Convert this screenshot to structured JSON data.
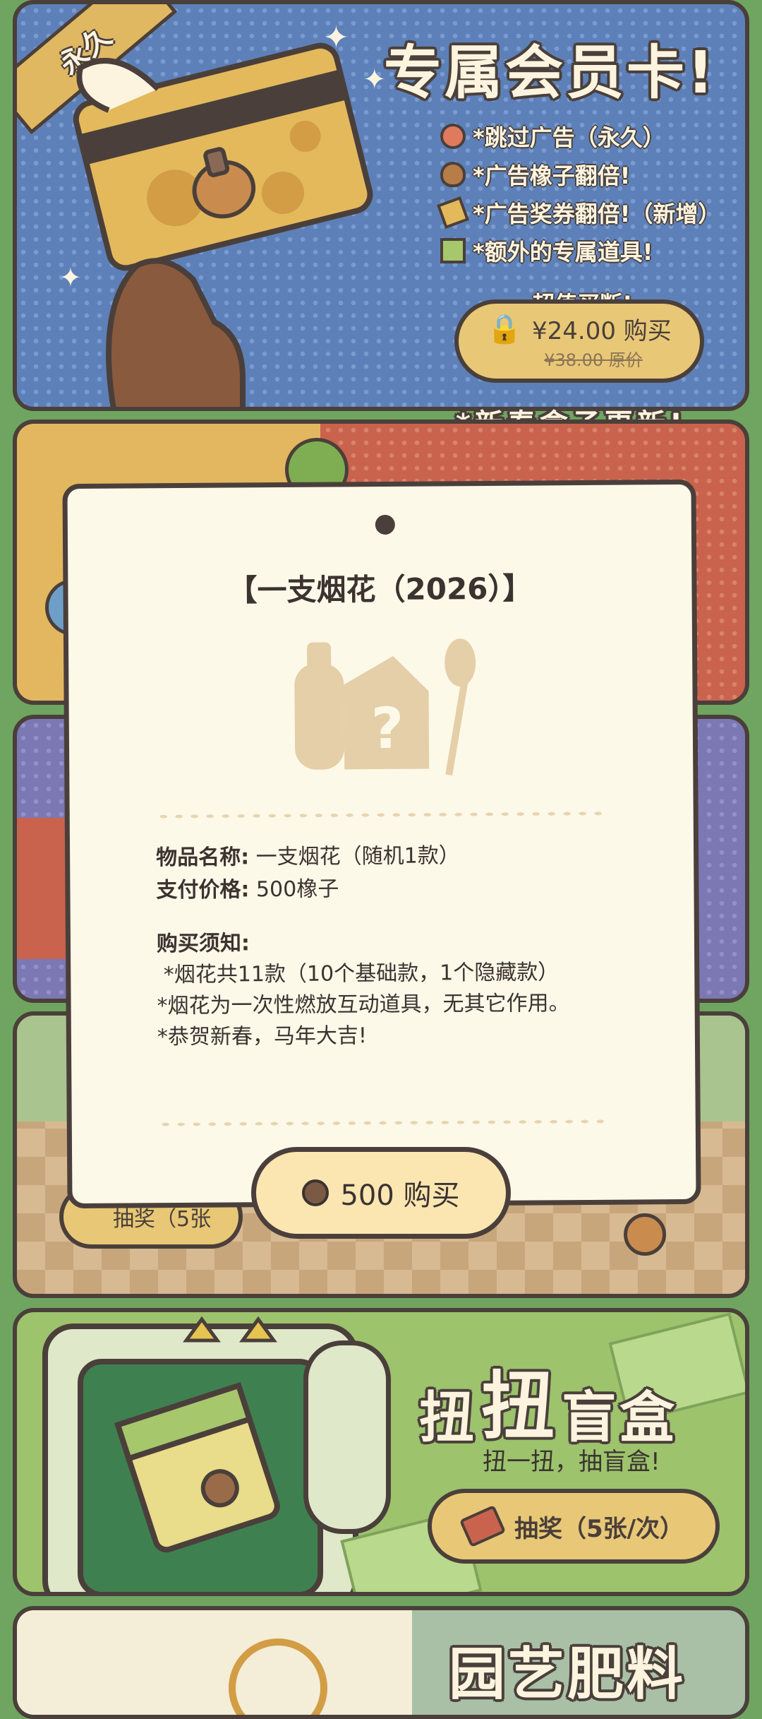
{
  "vip_card": {
    "corner_tag": "永久",
    "title": "专属会员卡!",
    "perks": [
      "*跳过广告（永久）",
      "*广告橡子翻倍!",
      "*广告奖券翻倍!（新增）",
      "*额外的专属道具!"
    ],
    "badge": "超值买断!",
    "price": "¥24.00 购买",
    "original_price": "¥38.00 原价"
  },
  "spring_notice": "*新春盒子更新!",
  "gacha": {
    "title_part1": "扭",
    "title_part2": "扭",
    "title_part3": "盲盒",
    "subtitle": "扭一扭，抽盲盒!",
    "button": "抽奖（5张/次）"
  },
  "behind_modal": {
    "button_fragment": "抽奖（5张"
  },
  "garden": {
    "title": "园艺肥料"
  },
  "modal": {
    "title": "【一支烟花（2026）】",
    "item_name_label": "物品名称:",
    "item_name": "一支烟花（随机1款）",
    "price_label": "支付价格:",
    "price": "500橡子",
    "notice_label": "购买须知:",
    "notice_lines": [
      " *烟花共11款（10个基础款，1个隐藏款）",
      "*烟花为一次性燃放互动道具，无其它作用。",
      "*恭贺新春，马年大吉!"
    ],
    "buy_button": "500 购买"
  },
  "colors": {
    "outline": "#4a3f3a",
    "modal_bg": "#fdf9e9",
    "button_gold": "#e8c877",
    "page_green": "#6fa560"
  }
}
